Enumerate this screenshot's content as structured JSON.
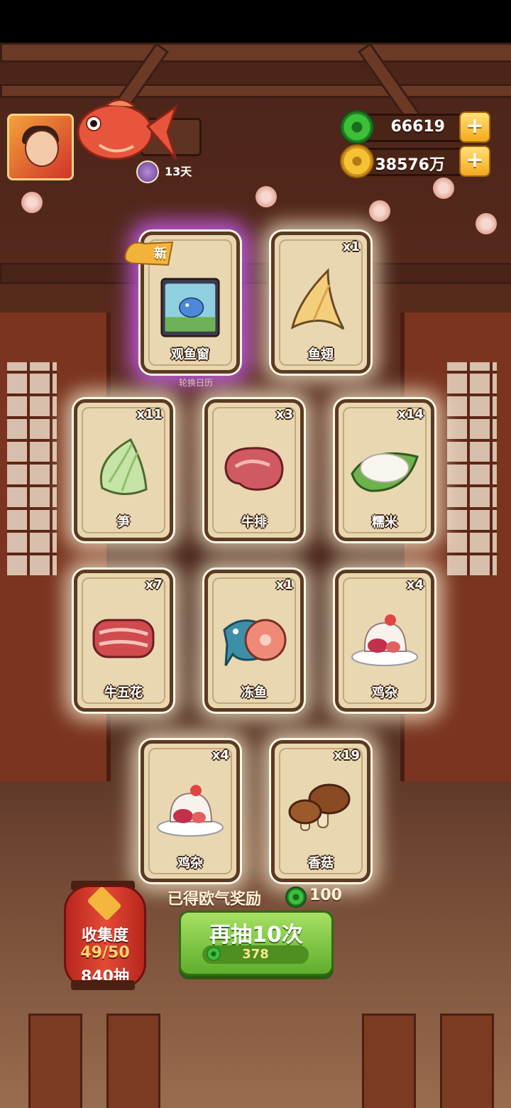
{
  "hud": {
    "days": "13天",
    "jade": "66619",
    "coins": "38576万",
    "plus_label": "+"
  },
  "new_tag": "新",
  "rotate_label": "轮换日历",
  "cards": [
    {
      "name": "观鱼窗",
      "count": "",
      "is_new": true
    },
    {
      "name": "鱼翅",
      "count": "x1"
    },
    {
      "name": "笋",
      "count": "x11"
    },
    {
      "name": "牛排",
      "count": "x3"
    },
    {
      "name": "糯米",
      "count": "x14"
    },
    {
      "name": "牛五花",
      "count": "x7"
    },
    {
      "name": "冻鱼",
      "count": "x1"
    },
    {
      "name": "鸡杂",
      "count": "x4"
    },
    {
      "name": "鸡杂",
      "count": "x4"
    },
    {
      "name": "香菇",
      "count": "x19"
    }
  ],
  "luck": {
    "label": "已得欧气奖励",
    "value": "100"
  },
  "draw_button": {
    "label": "再抽10次",
    "cost": "378"
  },
  "collection": {
    "title": "收集度",
    "progress": "49/50",
    "draws": "840抽"
  },
  "colors": {
    "accent_green": "#5fae2c",
    "lantern_red": "#e34a36",
    "card_bg": "#e9d7b2",
    "rare_glow": "#c45ceb"
  }
}
